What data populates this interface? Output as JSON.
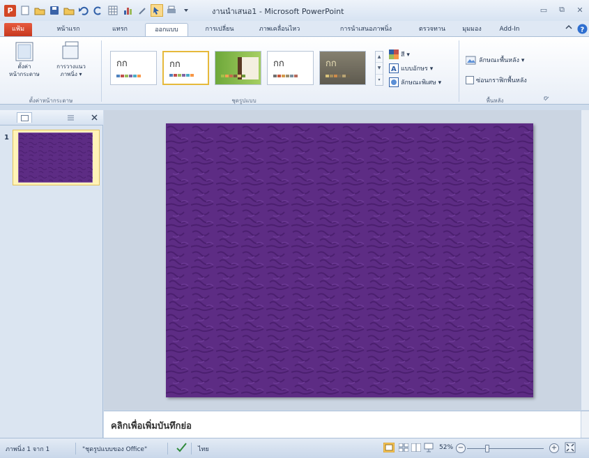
{
  "window": {
    "title": "งานนำเสนอ1 - Microsoft PowerPoint",
    "app_icon_letter": "P",
    "controls": {
      "minimize": "▭",
      "restore": "⧉",
      "close": "✕"
    }
  },
  "tabs": {
    "file": "แฟ้ม",
    "home": "หน้าแรก",
    "insert": "แทรก",
    "design": "ออกแบบ",
    "transitions": "การเปลี่ยน",
    "animations": "ภาพเคลื่อนไหว",
    "slideshow": "การนำเสนอภาพนิ่ง",
    "review": "ตรวจทาน",
    "view": "มุมมอง",
    "addins": "Add-In"
  },
  "ribbon": {
    "page_setup": {
      "setup_label": "ตั้งค่าหน้ากระดาษ",
      "setup_label_l1": "ตั้งค่า",
      "setup_label_l2": "หน้ากระดาษ",
      "orientation_l1": "การวางแนว",
      "orientation_l2": "ภาพนิ่ง ▾",
      "group": "ตั้งค่าหน้ากระดาษ"
    },
    "themes": {
      "group": "ชุดรูปแบบ",
      "items": [
        {
          "letters": "กก",
          "colors": [
            "#4f81bd",
            "#c0504d",
            "#9bbb59",
            "#8064a2",
            "#4bacc6",
            "#f79646"
          ],
          "bg": "#ffffff"
        },
        {
          "letters": "กก",
          "colors": [
            "#4f81bd",
            "#c0504d",
            "#9bbb59",
            "#8064a2",
            "#4bacc6",
            "#f79646"
          ],
          "bg": "#ffffff"
        },
        {
          "letters": "",
          "colors": [
            "#a5c249",
            "#f2a24f",
            "#c86d4b",
            "#7d5a3c",
            "#e0c070",
            "#6e9a3a"
          ],
          "bg": "#8dbd4e"
        },
        {
          "letters": "กก",
          "colors": [
            "#6f6f6f",
            "#c7573d",
            "#d49b4b",
            "#9a8e6e",
            "#7b8f9d",
            "#b46b5e"
          ],
          "bg": "#ffffff"
        },
        {
          "letters": "กก",
          "colors": [
            "#d8c27a",
            "#a88e5a",
            "#cc8a4a",
            "#7d7057",
            "#b9a473",
            "#6f644e"
          ],
          "bg": "#6f6a5e"
        }
      ]
    },
    "theme_options": {
      "colors": "สี ▾",
      "fonts": "แบบอักษร ▾",
      "effects": "ลักษณะพิเศษ ▾"
    },
    "background": {
      "group": "พื้นหลัง",
      "styles": "ลักษณะพื้นหลัง ▾",
      "hide": "ซ่อนกราฟิกพื้นหลัง"
    }
  },
  "slides_pane": {
    "slide_number": "1"
  },
  "slide": {
    "background_color": "#5d2c84"
  },
  "notes": {
    "placeholder": "คลิกเพื่อเพิ่มบันทึกย่อ"
  },
  "status": {
    "slide_of": "ภาพนิ่ง 1 จาก 1",
    "theme": "\"ชุดรูปแบบของ Office\"",
    "language": "ไทย",
    "zoom": "52%",
    "zoom_level": 0.52
  }
}
